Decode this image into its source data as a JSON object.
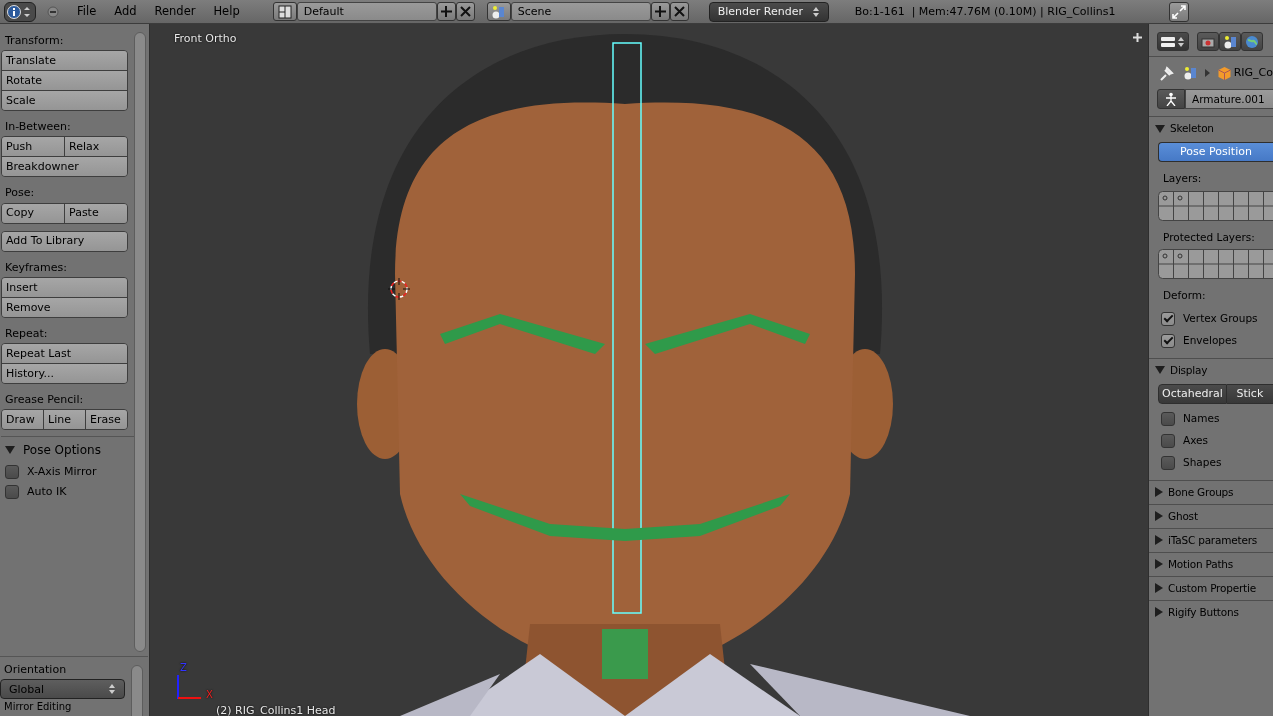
{
  "top_bar": {
    "menus": [
      "File",
      "Add",
      "Render",
      "Help"
    ],
    "screen_layout": "Default",
    "scene": "Scene",
    "render_engine": "Blender Render",
    "stats": "Bo:1-161  | Mem:47.76M (0.10M) | RIG_Collins1"
  },
  "tool_shelf": {
    "sections": [
      {
        "title": "Transform:",
        "rows": [
          [
            "Translate"
          ],
          [
            "Rotate"
          ],
          [
            "Scale"
          ]
        ]
      },
      {
        "title": "In-Between:",
        "rows": [
          [
            "Push",
            "Relax"
          ],
          [
            "Breakdowner"
          ]
        ]
      },
      {
        "title": "Pose:",
        "rows": [
          [
            "Copy",
            "Paste"
          ]
        ]
      },
      {
        "rows": [
          [
            "Add To Library"
          ]
        ]
      },
      {
        "title": "Keyframes:",
        "rows": [
          [
            "Insert"
          ],
          [
            "Remove"
          ]
        ]
      },
      {
        "title": "Repeat:",
        "rows": [
          [
            "Repeat Last"
          ],
          [
            "History..."
          ]
        ]
      },
      {
        "title": "Grease Pencil:",
        "rows": [
          [
            "Draw",
            "Line",
            "Erase"
          ]
        ]
      }
    ],
    "pose_options": {
      "title": "Pose Options",
      "expanded": true,
      "options": [
        {
          "label": "X-Axis Mirror",
          "checked": false
        },
        {
          "label": "Auto IK",
          "checked": false
        }
      ]
    },
    "orientation": {
      "label": "Orientation",
      "value": "Global"
    },
    "mirror_editing": "Mirror Editing"
  },
  "viewport": {
    "view_name": "Front Ortho",
    "object_info": "(2) RIG_Collins1 Head",
    "axis_z": "Z",
    "axis_x": "X"
  },
  "properties": {
    "breadcrumb": "RIG_Co",
    "datablock": "Armature.001",
    "panels": [
      {
        "kind": "skeleton",
        "title": "Skeleton",
        "expanded": true,
        "pose_position": {
          "label": "Pose Position",
          "selected": true
        },
        "layers_label": "Layers:",
        "protected_label": "Protected Layers:",
        "deform_label": "Deform:",
        "deform": [
          {
            "label": "Vertex Groups",
            "checked": true
          },
          {
            "label": "Envelopes",
            "checked": true
          }
        ]
      },
      {
        "kind": "display",
        "title": "Display",
        "expanded": true,
        "modes": [
          {
            "label": "Octahedral",
            "selected": false
          },
          {
            "label": "Stick",
            "selected": false
          }
        ],
        "options": [
          {
            "label": "Names",
            "checked": false
          },
          {
            "label": "Axes",
            "checked": false
          },
          {
            "label": "Shapes",
            "checked": false
          }
        ]
      },
      {
        "title": "Bone Groups",
        "expanded": false
      },
      {
        "title": "Ghost",
        "expanded": false
      },
      {
        "title": "iTaSC parameters",
        "expanded": false
      },
      {
        "title": "Motion Paths",
        "expanded": false
      },
      {
        "title": "Custom Propertie",
        "expanded": false
      },
      {
        "title": "Rigify Buttons",
        "expanded": false
      }
    ]
  }
}
